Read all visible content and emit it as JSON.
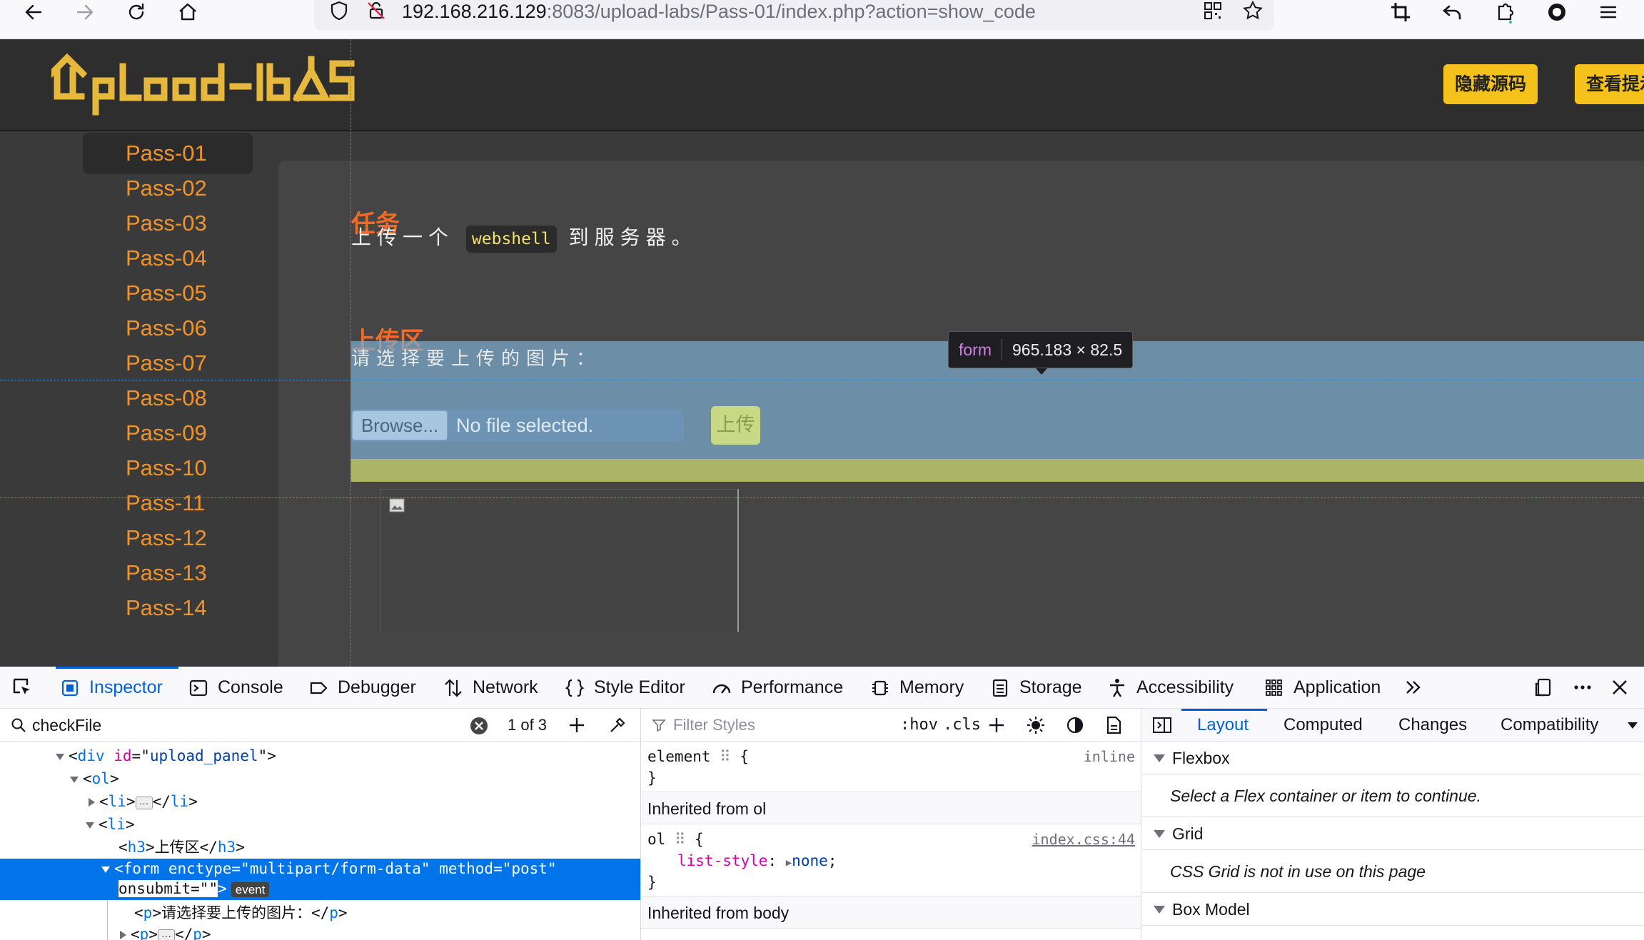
{
  "browser": {
    "url_host": "192.168.216.129",
    "url_rest": ":8083/upload-labs/Pass-01/index.php?action=show_code"
  },
  "site": {
    "logo_text": "UpLoad-labs",
    "hide_source_label": "隐藏源码",
    "view_hint_label": "查看提示"
  },
  "sidebar": {
    "items": [
      "Pass-01",
      "Pass-02",
      "Pass-03",
      "Pass-04",
      "Pass-05",
      "Pass-06",
      "Pass-07",
      "Pass-08",
      "Pass-09",
      "Pass-10",
      "Pass-11",
      "Pass-12",
      "Pass-13",
      "Pass-14"
    ],
    "active": "Pass-01"
  },
  "content": {
    "task_title": "任务",
    "task_prefix": "上传一个",
    "task_code": "webshell",
    "task_suffix": "到服务器。",
    "upload_title": "上传区",
    "prompt": "请选择要上传的图片：",
    "browse_label": "Browse...",
    "no_file_label": "No file selected.",
    "upload_label": "上传"
  },
  "highlighter": {
    "tag": "form",
    "dimensions": "965.183 × 82.5"
  },
  "devtools": {
    "tabs": [
      "Inspector",
      "Console",
      "Debugger",
      "Network",
      "Style Editor",
      "Performance",
      "Memory",
      "Storage",
      "Accessibility",
      "Application"
    ],
    "active_tab": "Inspector",
    "search_value": "checkFile",
    "search_count": "1 of 3",
    "markup": {
      "div_tag": "div",
      "div_attr": "id",
      "div_val": "upload_panel",
      "ol": "ol",
      "li": "li",
      "h3_text": "上传区",
      "form_enctype": "multipart/form-data",
      "form_method": "post",
      "form_onsubmit": "",
      "event_badge": "event",
      "p_text": "请选择要上传的图片："
    },
    "rules": {
      "filter_placeholder": "Filter Styles",
      "hov": ":hov",
      "cls": ".cls",
      "element_selector": "element",
      "inline_label": "inline",
      "inherited_ol": "Inherited from ol",
      "ol_selector": "ol",
      "ol_source": "index.css:44",
      "prop": "list-style",
      "value": "none",
      "inherited_body": "Inherited from body"
    },
    "layout": {
      "tabs": [
        "Layout",
        "Computed",
        "Changes",
        "Compatibility"
      ],
      "active_tab": "Layout",
      "flexbox_title": "Flexbox",
      "flexbox_msg": "Select a Flex container or item to continue.",
      "grid_title": "Grid",
      "grid_msg": "CSS Grid is not in use on this page",
      "box_model_title": "Box Model"
    }
  }
}
